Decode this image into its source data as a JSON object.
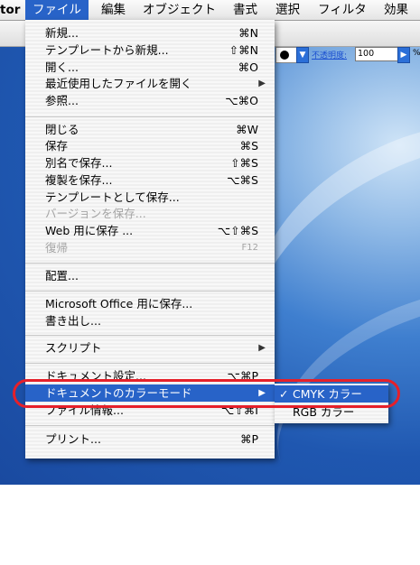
{
  "menubar": {
    "app_fragment": "tor",
    "items": [
      "ファイル",
      "編集",
      "オブジェクト",
      "書式",
      "選択",
      "フィルタ",
      "効果"
    ]
  },
  "toolbar": {
    "opacity_label": "不透明度:",
    "opacity_value": "100",
    "percent": "%"
  },
  "file_menu": [
    {
      "label": "新規...",
      "shortcut": "⌘N"
    },
    {
      "label": "テンプレートから新規...",
      "shortcut": "⇧⌘N"
    },
    {
      "label": "開く...",
      "shortcut": "⌘O"
    },
    {
      "label": "最近使用したファイルを開く",
      "shortcut": "",
      "submenu": true
    },
    {
      "label": "参照...",
      "shortcut": "⌥⌘O"
    },
    {
      "label": "閉じる",
      "shortcut": "⌘W"
    },
    {
      "label": "保存",
      "shortcut": "⌘S"
    },
    {
      "label": "別名で保存...",
      "shortcut": "⇧⌘S"
    },
    {
      "label": "複製を保存...",
      "shortcut": "⌥⌘S"
    },
    {
      "label": "テンプレートとして保存...",
      "shortcut": ""
    },
    {
      "label": "バージョンを保存...",
      "shortcut": "",
      "disabled": true
    },
    {
      "label": "Web 用に保存 ...",
      "shortcut": "⌥⇧⌘S"
    },
    {
      "label": "復帰",
      "shortcut": "F12",
      "disabled": true
    },
    {
      "label": "配置...",
      "shortcut": ""
    },
    {
      "label": "Microsoft Office 用に保存...",
      "shortcut": ""
    },
    {
      "label": "書き出し...",
      "shortcut": ""
    },
    {
      "label": "スクリプト",
      "shortcut": "",
      "submenu": true
    },
    {
      "label": "ドキュメント設定...",
      "shortcut": "⌥⌘P"
    },
    {
      "label": "ドキュメントのカラーモード",
      "shortcut": "",
      "submenu": true,
      "highlighted": true
    },
    {
      "label": "ファイル情報...",
      "shortcut": "⌥⇧⌘I"
    },
    {
      "label": "プリント...",
      "shortcut": "⌘P"
    }
  ],
  "color_mode_submenu": [
    {
      "label": "CMYK カラー",
      "checked": true,
      "highlighted": true
    },
    {
      "label": "RGB カラー",
      "checked": false
    }
  ],
  "check_mark": "✓",
  "submenu_arrow": "▶",
  "colors": {
    "highlight": "#2863c8",
    "annotation_ring": "#e5202a"
  },
  "icons": [
    "dropdown-arrow-icon",
    "submenu-arrow-icon",
    "checkmark-icon"
  ]
}
